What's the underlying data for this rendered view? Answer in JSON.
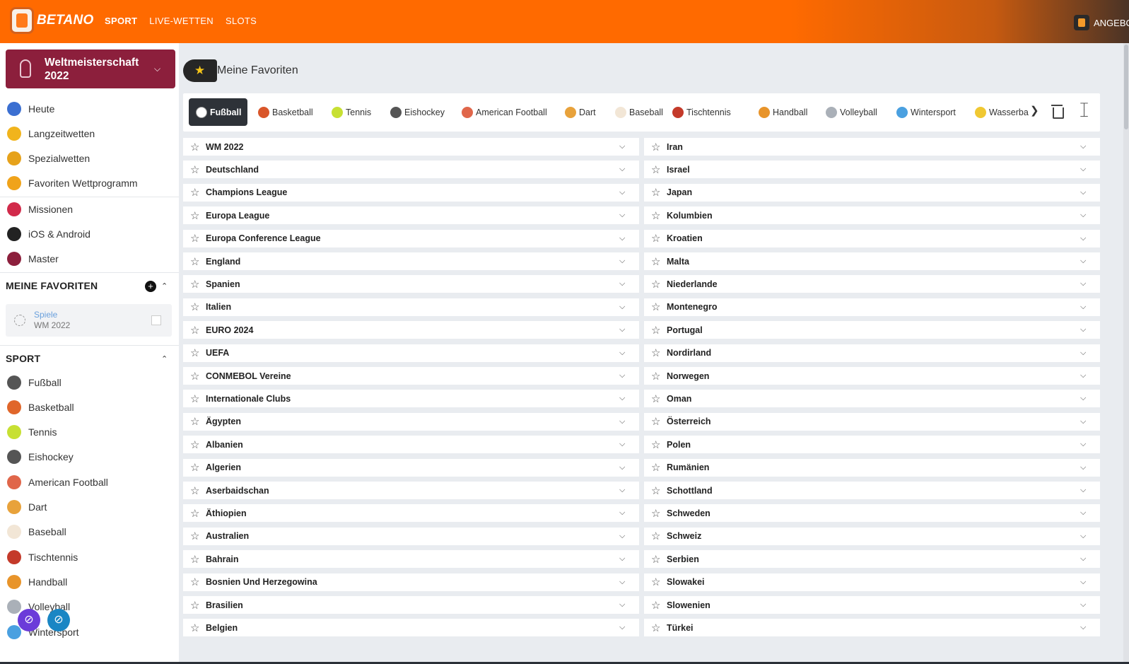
{
  "header": {
    "brand": "BETANO",
    "nav": [
      "SPORT",
      "LIVE-WETTEN",
      "SLOTS"
    ],
    "offers_label": "ANGEBO"
  },
  "sidebar": {
    "featured": {
      "title": "Weltmeisterschaft 2022"
    },
    "top_items": [
      {
        "label": "Heute",
        "icon": "calendar-icon",
        "color": "#3b6fd1"
      },
      {
        "label": "Langzeitwetten",
        "icon": "trophy-icon",
        "color": "#f1b41c"
      },
      {
        "label": "Spezialwetten",
        "icon": "star-badge-icon",
        "color": "#e6a21b"
      },
      {
        "label": "Favoriten Wettprogramm",
        "icon": "medal-icon",
        "color": "#f0a31a"
      },
      {
        "label": "Missionen",
        "icon": "target-icon",
        "color": "#d12a4a"
      },
      {
        "label": "iOS & Android",
        "icon": "apple-android-icon",
        "color": "#222222"
      },
      {
        "label": "Master",
        "icon": "master-icon",
        "color": "#8c1f3c"
      }
    ],
    "favorites": {
      "heading": "MEINE FAVORITEN",
      "card": {
        "line1": "Spiele",
        "line2": "WM 2022"
      }
    },
    "sport": {
      "heading": "SPORT",
      "items": [
        {
          "label": "Fußball",
          "icon": "soccer-ball-icon",
          "color": "#555555"
        },
        {
          "label": "Basketball",
          "icon": "basketball-icon",
          "color": "#e0662a"
        },
        {
          "label": "Tennis",
          "icon": "tennis-ball-icon",
          "color": "#c7e033"
        },
        {
          "label": "Eishockey",
          "icon": "hockey-sticks-icon",
          "color": "#555555"
        },
        {
          "label": "American Football",
          "icon": "american-football-icon",
          "color": "#e0664a"
        },
        {
          "label": "Dart",
          "icon": "dart-icon",
          "color": "#e8a23b"
        },
        {
          "label": "Baseball",
          "icon": "baseball-icon",
          "color": "#f2e6d6"
        },
        {
          "label": "Tischtennis",
          "icon": "table-tennis-icon",
          "color": "#c43a2a"
        },
        {
          "label": "Handball",
          "icon": "handball-icon",
          "color": "#e8942a"
        },
        {
          "label": "Volleyball",
          "icon": "volleyball-icon",
          "color": "#aab0b8"
        },
        {
          "label": "Wintersport",
          "icon": "snowflake-icon",
          "color": "#4aa0e0"
        }
      ]
    }
  },
  "main": {
    "title": "Meine Favoriten",
    "tabs": [
      {
        "label": "Fußball",
        "icon": "soccer-ball-icon",
        "color": "#ffffff",
        "active": true
      },
      {
        "label": "Basketball",
        "icon": "basketball-icon",
        "color": "#d9562a"
      },
      {
        "label": "Tennis",
        "icon": "tennis-ball-icon",
        "color": "#c7e033"
      },
      {
        "label": "Eishockey",
        "icon": "hockey-sticks-icon",
        "color": "#555555"
      },
      {
        "label": "American Football",
        "icon": "american-football-icon",
        "color": "#e0664a"
      },
      {
        "label": "Dart",
        "icon": "dart-icon",
        "color": "#e8a23b"
      },
      {
        "label": "Baseball",
        "icon": "baseball-icon",
        "color": "#f2e6d6"
      },
      {
        "label": "Tischtennis",
        "icon": "table-tennis-icon",
        "color": "#c43a2a"
      },
      {
        "label": "Handball",
        "icon": "handball-icon",
        "color": "#e8942a"
      },
      {
        "label": "Volleyball",
        "icon": "volleyball-icon",
        "color": "#aab0b8"
      },
      {
        "label": "Wintersport",
        "icon": "snowflake-icon",
        "color": "#4aa0e0"
      },
      {
        "label": "Wasserba",
        "icon": "water-polo-icon",
        "color": "#f0c832"
      }
    ],
    "left_list": [
      "WM 2022",
      "Deutschland",
      "Champions League",
      "Europa League",
      "Europa Conference League",
      "England",
      "Spanien",
      "Italien",
      "EURO 2024",
      "UEFA",
      "CONMEBOL Vereine",
      "Internationale Clubs",
      "Ägypten",
      "Albanien",
      "Algerien",
      "Aserbaidschan",
      "Äthiopien",
      "Australien",
      "Bahrain",
      "Bosnien Und Herzegowina",
      "Brasilien",
      "Belgien"
    ],
    "right_list": [
      "Iran",
      "Israel",
      "Japan",
      "Kolumbien",
      "Kroatien",
      "Malta",
      "Niederlande",
      "Montenegro",
      "Portugal",
      "Nordirland",
      "Norwegen",
      "Oman",
      "Österreich",
      "Polen",
      "Rumänien",
      "Schottland",
      "Schweden",
      "Schweiz",
      "Serbien",
      "Slowakei",
      "Slowenien",
      "Türkei"
    ]
  },
  "colors": {
    "brand_orange": "#ff6a00",
    "featured_bg": "#8c1f3c",
    "active_tab_bg": "#2e3238"
  }
}
